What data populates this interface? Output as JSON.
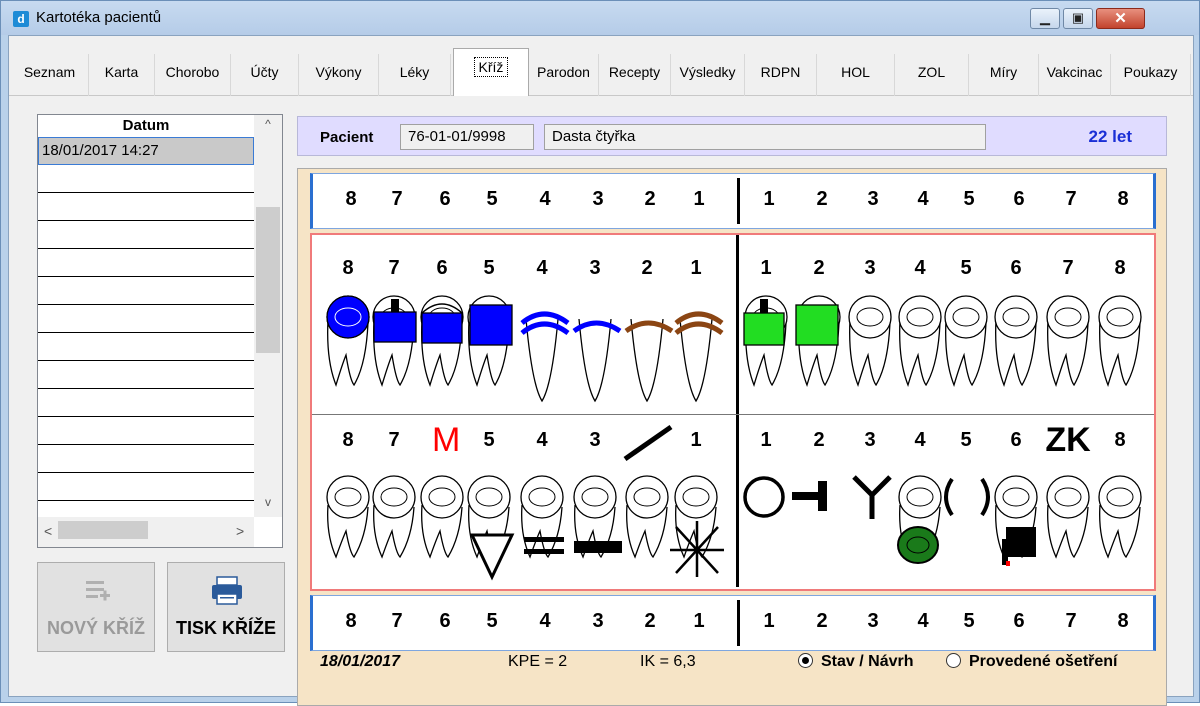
{
  "window": {
    "title": "Kartotéka pacientů",
    "app_icon": "d"
  },
  "tabs": [
    {
      "label": "Seznam"
    },
    {
      "label": "Karta"
    },
    {
      "label": "Chorobo"
    },
    {
      "label": "Účty"
    },
    {
      "label": "Výkony"
    },
    {
      "label": "Léky"
    },
    {
      "label": "Kříž",
      "active": true
    },
    {
      "label": "Parodon"
    },
    {
      "label": "Recepty"
    },
    {
      "label": "Výsledky"
    },
    {
      "label": "RDPN"
    },
    {
      "label": "HOL"
    },
    {
      "label": "ZOL"
    },
    {
      "label": "Míry"
    },
    {
      "label": "Vakcinac"
    },
    {
      "label": "Poukazy"
    }
  ],
  "date_list": {
    "header": "Datum",
    "rows": [
      "18/01/2017 14:27"
    ],
    "selected_index": 0
  },
  "buttons": {
    "new_cross": "NOVÝ KŘÍŽ",
    "print_cross": "TISK KŘÍŽE"
  },
  "patient": {
    "label": "Pacient",
    "id": "76-01-01/9998",
    "name": "Dasta čtyřka",
    "age": "22 let"
  },
  "chart": {
    "top_numbers": [
      "8",
      "7",
      "6",
      "5",
      "4",
      "3",
      "2",
      "1",
      "1",
      "2",
      "3",
      "4",
      "5",
      "6",
      "7",
      "8"
    ],
    "upper_numbers": [
      "8",
      "7",
      "6",
      "5",
      "4",
      "3",
      "2",
      "1",
      "1",
      "2",
      "3",
      "4",
      "5",
      "6",
      "7",
      "8"
    ],
    "lower_numbers": [
      "8",
      "7",
      "M",
      "5",
      "4",
      "3",
      "/",
      "1",
      "1",
      "2",
      "3",
      "4",
      "5",
      "6",
      "ZK",
      "8"
    ],
    "bottom_numbers": [
      "8",
      "7",
      "6",
      "5",
      "4",
      "3",
      "2",
      "1",
      "1",
      "2",
      "3",
      "4",
      "5",
      "6",
      "7",
      "8"
    ]
  },
  "footer": {
    "date": "18/01/2017",
    "kpe": "KPE = 2",
    "ik": "IK = 6,3",
    "radio_state": "Stav / Návrh",
    "radio_done": "Provedené ošetření",
    "selected": "state"
  },
  "colors": {
    "title_bar": "#b9d1ea",
    "patient_bar": "#e0dcff",
    "chart_bg": "#f6e4c6",
    "age_text": "#1a2fd6",
    "blue_fill": "#0000ff",
    "green_fill": "#22dd22",
    "brown": "#8b4513",
    "red_mark": "#ff0000"
  }
}
